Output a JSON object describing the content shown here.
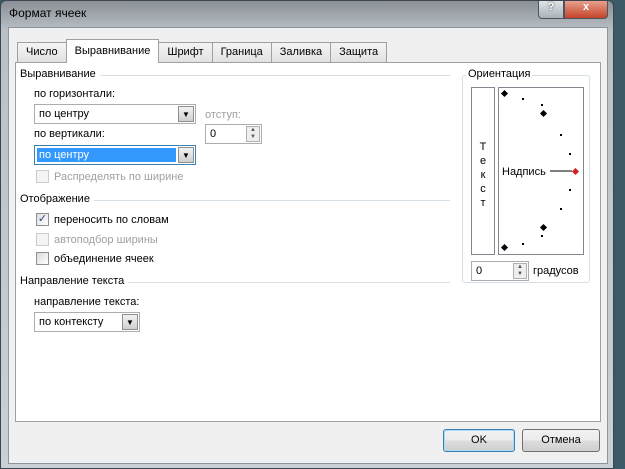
{
  "window": {
    "title": "Формат ячеек",
    "help_label": "?",
    "close_label": "x"
  },
  "tabs": [
    "Число",
    "Выравнивание",
    "Шрифт",
    "Граница",
    "Заливка",
    "Защита"
  ],
  "active_tab": "Выравнивание",
  "alignment": {
    "group_label": "Выравнивание",
    "horizontal_label": "по горизонтали:",
    "horizontal_value": "по центру",
    "indent_label": "отступ:",
    "indent_value": "0",
    "vertical_label": "по вертикали:",
    "vertical_value": "по центру",
    "distribute_label": "Распределять по ширине",
    "distribute_checked": false
  },
  "display": {
    "group_label": "Отображение",
    "wrap_label": "переносить по словам",
    "wrap_checked": true,
    "shrink_label": "автоподбор ширины",
    "shrink_checked": false,
    "merge_label": "объединение ячеек",
    "merge_checked": false
  },
  "direction": {
    "group_label": "Направление текста",
    "label": "направление текста:",
    "value": "по контексту"
  },
  "orientation": {
    "group_label": "Ориентация",
    "vertical_text": "Текст",
    "dial_label": "Надпись",
    "degrees_value": "0",
    "degrees_label": "градусов",
    "accent_color": "#d02020"
  },
  "buttons": {
    "ok": "OK",
    "cancel": "Отмена"
  }
}
